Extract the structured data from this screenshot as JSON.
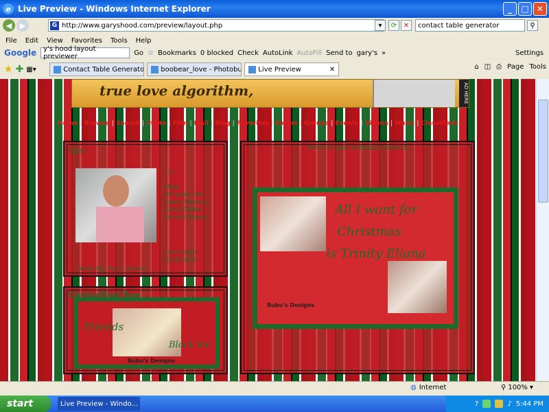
{
  "window": {
    "title": "Live Preview - Windows Internet Explorer"
  },
  "address": {
    "url": "http://www.garyshood.com/preview/layout.php"
  },
  "search": {
    "value": "contact table generator"
  },
  "menu": [
    "File",
    "Edit",
    "View",
    "Favorites",
    "Tools",
    "Help"
  ],
  "google_toolbar": {
    "brand": "Google",
    "query": "y's hood layout previewer",
    "go": "Go",
    "bookmarks": "Bookmarks",
    "blocked": "0 blocked",
    "check": "Check",
    "autolink": "AutoLink",
    "autofill": "AutoFill",
    "send_to": "Send to",
    "user": "gary's",
    "settings": "Settings"
  },
  "tabs": [
    {
      "label": "Contact Table Generator - A..."
    },
    {
      "label": "boobear_love - Photobucket ..."
    },
    {
      "label": "Live Preview"
    }
  ],
  "tab_tools": {
    "page": "Page",
    "tools": "Tools"
  },
  "banner": {
    "text": "true love algorithm,",
    "ad": "AD HERE"
  },
  "nav_links": [
    "Home",
    "Browse",
    "Search",
    "Invite",
    "Film",
    "Mail",
    "Blog",
    "Favorites",
    "Forum",
    "Groups",
    "Events",
    "Videos",
    "Music",
    "Classifieds"
  ],
  "profile": {
    "name": "Tom",
    "quote": "\":)\"",
    "gender": "Male",
    "age": "30 years old",
    "city": "Santa Monica,",
    "state": "CALIFORNIA",
    "country": "United States",
    "last_login_label": "Last Login:",
    "last_login": "5/19/2006",
    "view_links": "View My: Pics | Videos"
  },
  "contacting": {
    "title": "Contacting Tom",
    "friends": "Friends",
    "block": "Block me",
    "credit": "Bubu's Designs"
  },
  "extended": {
    "header": "Tom is in your extended network",
    "line1": "All I want for",
    "line2": "Christmas",
    "line3": "is Trinity Eliana",
    "credit": "Bubu's Designs"
  },
  "status_bar": {
    "zone": "Internet",
    "zoom": "100%"
  },
  "taskbar": {
    "start": "start",
    "task": "Live Preview - Windo...",
    "clock": "5:44 PM"
  }
}
